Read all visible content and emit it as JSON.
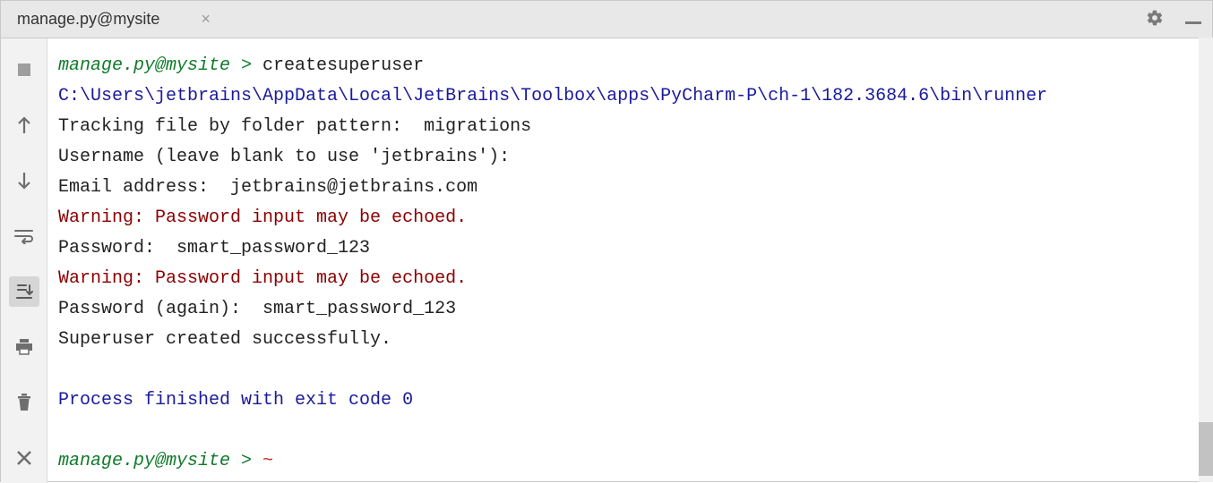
{
  "tab": {
    "title": "manage.py@mysite"
  },
  "console": {
    "prompt1": {
      "prefix": "manage.py@mysite > ",
      "command": "createsuperuser"
    },
    "path": "C:\\Users\\jetbrains\\AppData\\Local\\JetBrains\\Toolbox\\apps\\PyCharm-P\\ch-1\\182.3684.6\\bin\\runner",
    "tracking": "Tracking file by folder pattern:  migrations",
    "username_prompt": "Username (leave blank to use 'jetbrains'): ",
    "email_line": "Email address:  jetbrains@jetbrains.com",
    "warning1": "Warning: Password input may be echoed.",
    "password1_line": "Password:  smart_password_123",
    "warning2": "Warning: Password input may be echoed.",
    "password2_line": "Password (again):  smart_password_123",
    "success": "Superuser created successfully.",
    "exit": "Process finished with exit code 0",
    "prompt2": {
      "prefix": "manage.py@mysite > "
    }
  }
}
